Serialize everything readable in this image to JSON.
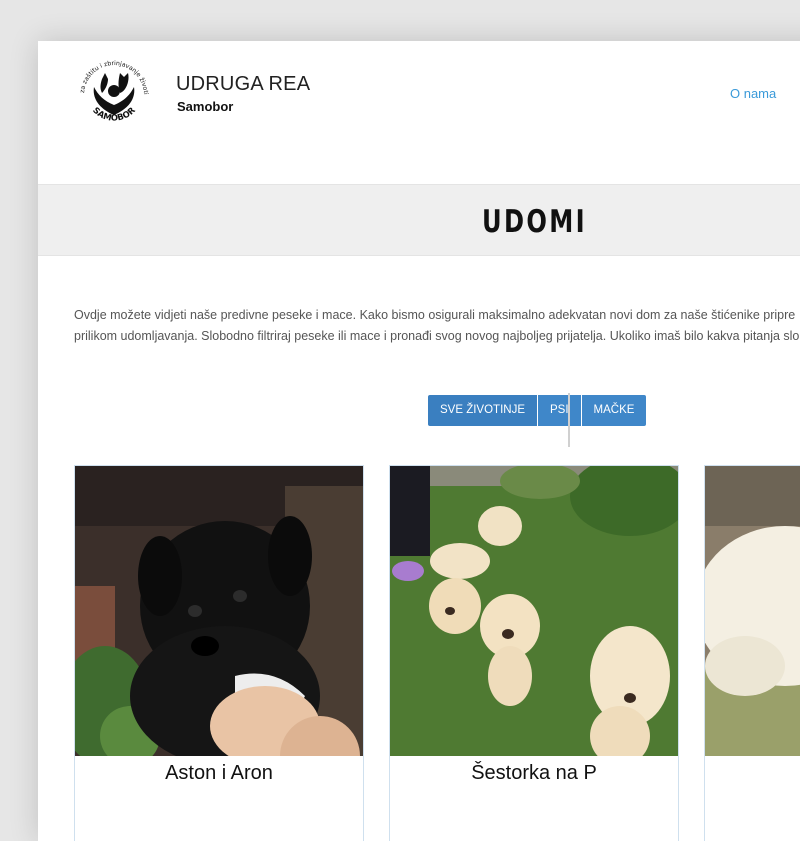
{
  "header": {
    "logo": {
      "text_top": "Udruga za zaštitu i zbrinjavanje životinja Rea",
      "text_bottom": "SAMOBOR"
    },
    "brand_name": "UDRUGA REA",
    "brand_sub": "Samobor",
    "nav": [
      {
        "label": "O nama"
      }
    ]
  },
  "page_title": "UDOMI",
  "intro": {
    "line1": "Ovdje možete vidjeti naše predivne peseke i mace. Kako bismo osigurali maksimalno adekvatan novi dom za naše štićenike pripre",
    "line2": "prilikom udomljavanja. Slobodno filtriraj peseke ili mace i pronađi svog novog najboljeg prijatelja. Ukoliko imaš bilo kakva pitanja slo"
  },
  "filters": [
    {
      "label": "SVE ŽIVOTINJE",
      "active": true
    },
    {
      "label": "PSI",
      "active": false
    },
    {
      "label": "MAČKE",
      "active": false
    }
  ],
  "animals": [
    {
      "name": "Aston i Aron"
    },
    {
      "name": "Šestorka na P"
    },
    {
      "name": ""
    }
  ],
  "colors": {
    "accent": "#3a9ad9",
    "button": "#3f87c9",
    "title_band": "#efefef"
  }
}
